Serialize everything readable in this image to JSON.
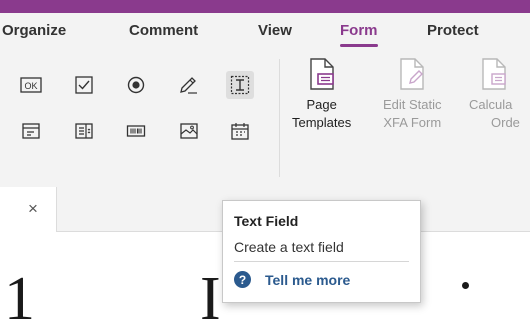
{
  "menu": {
    "items": [
      {
        "label": "Organize"
      },
      {
        "label": "Comment"
      },
      {
        "label": "View"
      },
      {
        "label": "Form"
      },
      {
        "label": "Protect"
      }
    ],
    "active": "Form"
  },
  "ribbon": {
    "tools": {
      "ok_label": "OK",
      "icons": [
        "push-button-icon",
        "check-box-icon",
        "radio-button-icon",
        "signature-field-icon",
        "text-field-icon",
        "combo-box-icon",
        "list-box-icon",
        "barcode-icon",
        "image-field-icon",
        "date-field-icon"
      ]
    },
    "page_templates": {
      "line1": "Page",
      "line2": "Templates"
    },
    "edit_static_xfa": {
      "line1": "Edit Static",
      "line2": "XFA Form"
    },
    "calculate_order": {
      "line1": "Calcula",
      "line2": "Orde"
    }
  },
  "tooltip": {
    "title": "Text Field",
    "description": "Create a text field",
    "help_icon": "?",
    "help_label": "Tell me more"
  },
  "document": {
    "tab_close": "×",
    "big_text_left": "1",
    "big_text_right": "I"
  },
  "colors": {
    "accent": "#8a3a8d",
    "ribbon_bg": "#f3f3f3",
    "help_blue": "#2b5a8e"
  }
}
